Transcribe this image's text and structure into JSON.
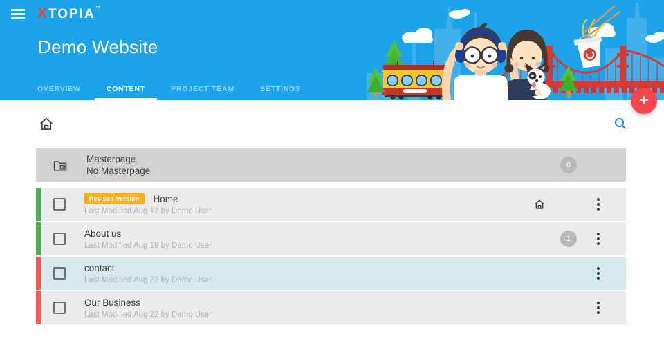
{
  "header": {
    "logo_x": "X",
    "logo_name": "TOPIA",
    "logo_tm": "™",
    "title": "Demo Website",
    "tabs": [
      {
        "label": "OVERVIEW",
        "active": false
      },
      {
        "label": "CONTENT",
        "active": true
      },
      {
        "label": "PROJECT TEAM",
        "active": false
      },
      {
        "label": "SETTINGS",
        "active": false
      }
    ]
  },
  "fab": {
    "label": "+"
  },
  "content": {
    "masterpage": {
      "title": "Masterpage",
      "subtitle": "No Masterpage",
      "count": "0"
    },
    "pages": [
      {
        "badge": "Revised Version",
        "title": "Home",
        "subtitle": "Last Modified Aug 12 by Demo User",
        "status_color": "#4caf50",
        "is_homepage": true,
        "selected": false
      },
      {
        "title": "About us",
        "subtitle": "Last Modified Aug 19 by Demo User",
        "status_color": "#4caf50",
        "count": "1",
        "selected": false
      },
      {
        "title": "contact",
        "subtitle": "Last Modified Aug 22 by Demo User",
        "status_color": "#f6564f",
        "selected": true
      },
      {
        "title": "Our Business",
        "subtitle": "Last Modified Aug 22 by Demo User",
        "status_color": "#f6564f",
        "selected": false
      }
    ]
  },
  "icons": {
    "menu": "hamburger-icon",
    "search": "search-icon",
    "breadcrumb": "home-icon",
    "masterpage": "masterpage-folder-icon",
    "homepage_marker": "home-icon",
    "row_menu": "vertical-dots-icon",
    "fab": "plus-icon"
  },
  "colors": {
    "header_blue": "#1ca3e9",
    "logo_red": "#e8403a",
    "fab_red": "#f3484b",
    "badge_amber": "#f9b016",
    "status_green": "#4caf50",
    "status_red": "#f6564f",
    "row_gray": "#ebebeb",
    "masterpage_gray": "#d2d2d2",
    "selected_row_blue": "#d7e8ec",
    "count_gray": "#b9b9b9",
    "search_blue": "#1a96e0"
  }
}
